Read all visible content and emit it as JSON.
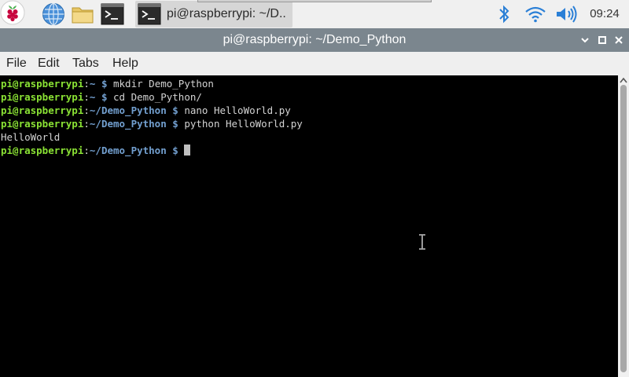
{
  "taskbar": {
    "task_label": "pi@raspberrypi: ~/D..",
    "clock": "09:24"
  },
  "window": {
    "title": "pi@raspberrypi: ~/Demo_Python"
  },
  "menu": {
    "file": "File",
    "edit": "Edit",
    "tabs": "Tabs",
    "help": "Help"
  },
  "terminal": {
    "lines": [
      {
        "user": "pi@raspberrypi",
        "colon": ":",
        "path": "~",
        "dollar": " $",
        "cmd": " mkdir Demo_Python"
      },
      {
        "user": "pi@raspberrypi",
        "colon": ":",
        "path": "~",
        "dollar": " $",
        "cmd": " cd Demo_Python/"
      },
      {
        "user": "pi@raspberrypi",
        "colon": ":",
        "path": "~/Demo_Python",
        "dollar": " $",
        "cmd": " nano HelloWorld.py"
      },
      {
        "user": "pi@raspberrypi",
        "colon": ":",
        "path": "~/Demo_Python",
        "dollar": " $",
        "cmd": " python HelloWorld.py"
      },
      {
        "output": "HelloWorld"
      },
      {
        "user": "pi@raspberrypi",
        "colon": ":",
        "path": "~/Demo_Python",
        "dollar": " $",
        "cmd": " "
      }
    ]
  },
  "colors": {
    "user": "#8ae234",
    "path": "#729fcf",
    "titlebar": "#7b868e",
    "terminal_bg": "#000000"
  }
}
